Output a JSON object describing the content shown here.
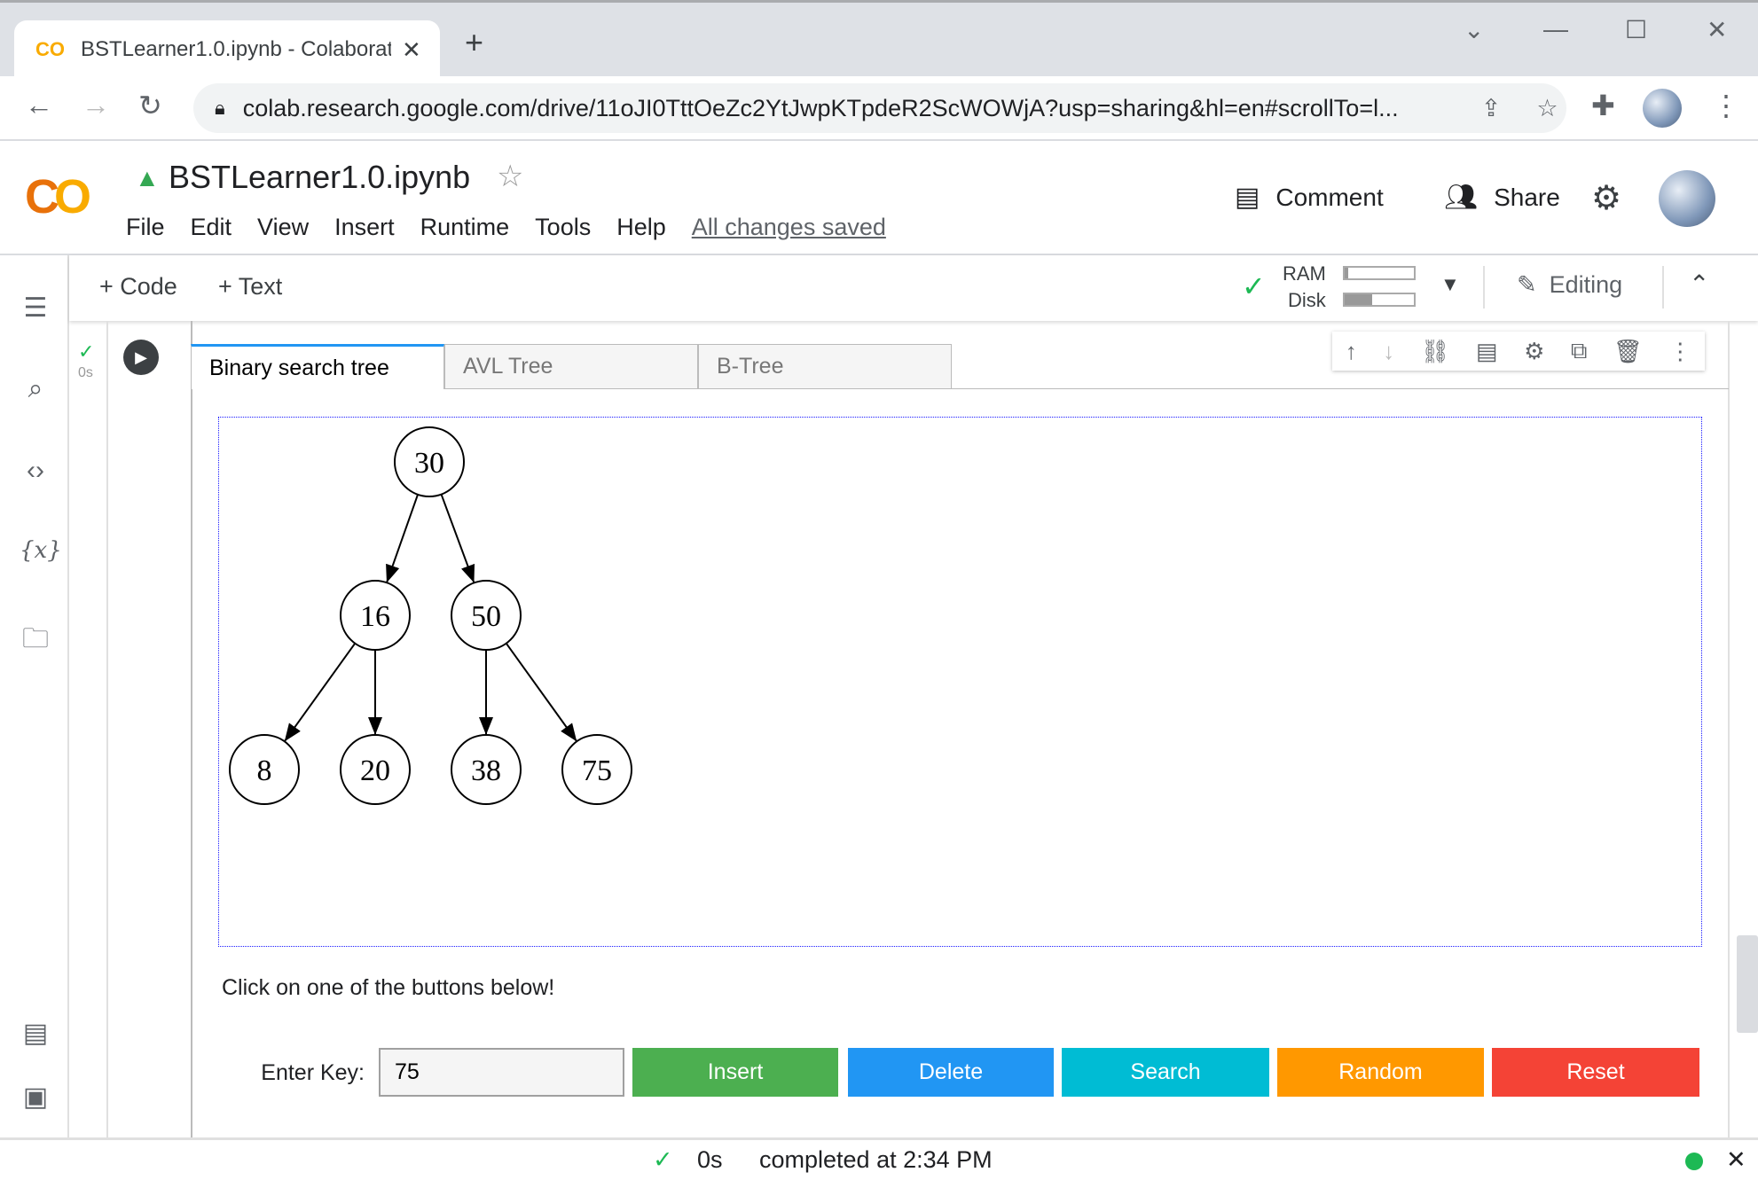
{
  "browser": {
    "tab_title": "BSTLearner1.0.ipynb - Colaboratory",
    "tab_icon": "CO",
    "url": "colab.research.google.com/drive/11oJI0TttOeZc2YtJwpKTpdeR2ScWOWjA?usp=sharing&hl=en#scrollTo=l..."
  },
  "header": {
    "logo": "CO",
    "filename": "BSTLearner1.0.ipynb",
    "menu": [
      "File",
      "Edit",
      "View",
      "Insert",
      "Runtime",
      "Tools",
      "Help"
    ],
    "saved_status": "All changes saved",
    "comment_label": "Comment",
    "share_label": "Share"
  },
  "toolbar": {
    "code_label": "+ Code",
    "text_label": "+ Text",
    "ram_label": "RAM",
    "disk_label": "Disk",
    "ram_usage": 0.05,
    "disk_usage": 0.4,
    "editing_label": "Editing"
  },
  "cell": {
    "exec_time": "0s",
    "tabs": [
      {
        "label": "Binary search tree",
        "active": true
      },
      {
        "label": "AVL Tree",
        "active": false
      },
      {
        "label": "B-Tree",
        "active": false
      }
    ],
    "tree": {
      "nodes": [
        "30",
        "16",
        "50",
        "8",
        "20",
        "38",
        "75"
      ],
      "edges": [
        [
          0,
          1
        ],
        [
          0,
          2
        ],
        [
          1,
          3
        ],
        [
          1,
          4
        ],
        [
          2,
          5
        ],
        [
          2,
          6
        ]
      ]
    },
    "prompt": "Click on one of the buttons below!",
    "key_label": "Enter Key:",
    "key_value": "75",
    "buttons": [
      {
        "label": "Insert",
        "color": "#4caf50"
      },
      {
        "label": "Delete",
        "color": "#2196f3"
      },
      {
        "label": "Search",
        "color": "#00bcd4"
      },
      {
        "label": "Random",
        "color": "#ff9800"
      },
      {
        "label": "Reset",
        "color": "#f44336"
      }
    ]
  },
  "status": {
    "time": "0s",
    "message": "completed at 2:34 PM",
    "connected_color": "#1db954"
  }
}
